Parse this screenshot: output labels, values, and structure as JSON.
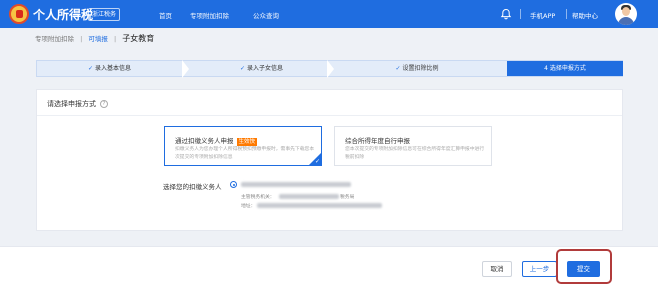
{
  "topbar": {
    "app_title": "个人所得税",
    "region": "浙江税务",
    "nav": [
      "首页",
      "专项附加扣除",
      "公众查询"
    ],
    "mobile_app": "手机APP",
    "help_center": "帮助中心"
  },
  "breadcrumb": {
    "root": "专项附加扣除",
    "parent": "可填报",
    "current": "子女教育"
  },
  "steps": [
    {
      "label": "录入基本信息",
      "done": true
    },
    {
      "label": "录入子女信息",
      "done": true
    },
    {
      "label": "设置扣除比例",
      "done": true
    },
    {
      "label": "4 选择申报方式",
      "done": false
    }
  ],
  "step_check": "✓",
  "form": {
    "section_title": "请选择申报方式",
    "help_glyph": "?",
    "option1": {
      "title": "通过扣缴义务人申报",
      "badge": "生效快",
      "desc": "扣缴义务人为您办理个人所得税预扣预缴申报时，需事先下载您本次提交的专项附加扣除信息"
    },
    "option2": {
      "title": "综合所得年度自行申报",
      "desc": "您本次提交的专项附加扣除信息可在综合所得年度汇算申报中进行税前扣除"
    },
    "agent_label": "选择您的扣缴义务人",
    "agent_field1_label": "主管税务机关：",
    "agent_field1_value_tail": "税务局",
    "agent_field2_label": "地址："
  },
  "footer": {
    "cancel": "取消",
    "prev": "上一步",
    "submit": "提交"
  },
  "colors": {
    "primary": "#1f6de0",
    "badge": "#ff7a00",
    "highlight": "#b13b3b"
  }
}
